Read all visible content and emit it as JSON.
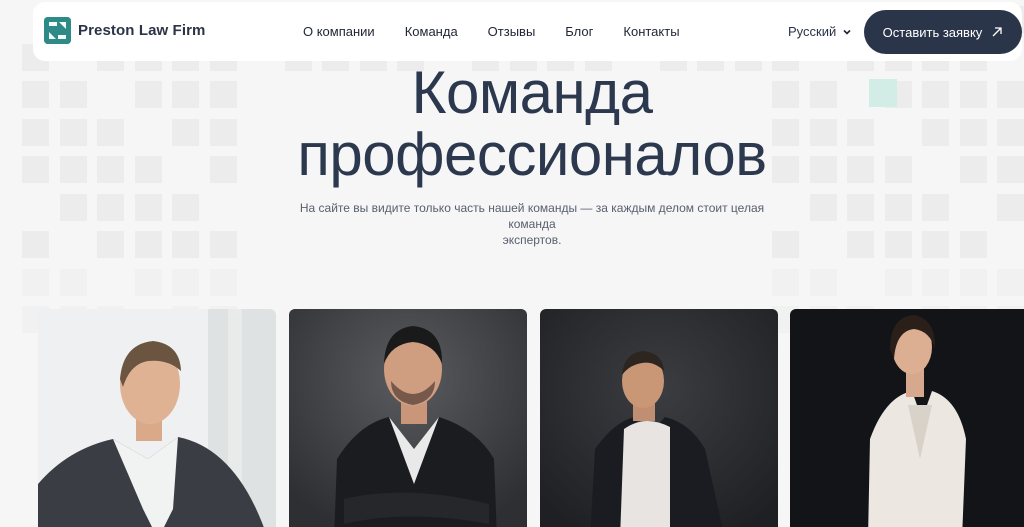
{
  "brand": {
    "name": "Preston Law Firm",
    "logo_color": "#2d8a86"
  },
  "nav": {
    "items": [
      {
        "label": "О компании"
      },
      {
        "label": "Команда"
      },
      {
        "label": "Отзывы"
      },
      {
        "label": "Блог"
      },
      {
        "label": "Контакты"
      }
    ]
  },
  "language": {
    "selected": "Русский",
    "icon": "chevron-down-icon"
  },
  "cta": {
    "label": "Оставить заявку",
    "icon": "arrow-up-right-icon",
    "color": "#2b3549"
  },
  "hero": {
    "title_line1": "Команда",
    "title_line2": "профессионалов",
    "subtitle_line1": "На сайте вы видите только часть нашей команды — за каждым делом стоит целая команда",
    "subtitle_line2": "экспертов."
  },
  "team": {
    "members": [
      {
        "photo": "team-member-photo-1"
      },
      {
        "photo": "team-member-photo-2"
      },
      {
        "photo": "team-member-photo-3"
      },
      {
        "photo": "team-member-photo-4"
      }
    ]
  }
}
